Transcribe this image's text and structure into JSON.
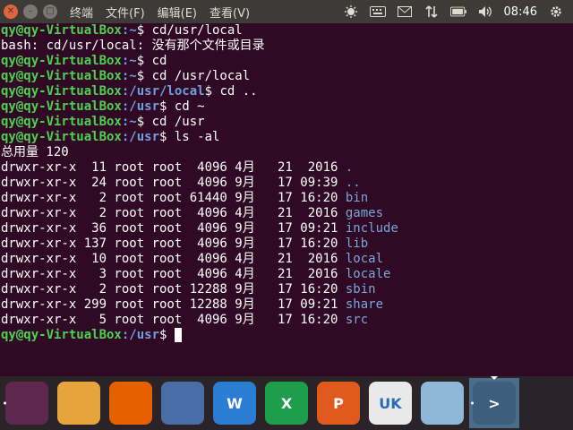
{
  "menubar": {
    "items": [
      "终端",
      "文件(F)",
      "编辑(E)",
      "查看(V)"
    ],
    "clock": "08:46"
  },
  "terminal": {
    "user_host": "qy@qy-VirtualBox",
    "lines": [
      {
        "type": "prompt",
        "path": ":~",
        "sym": "$ ",
        "cmd": "cd/usr/local"
      },
      {
        "type": "out",
        "text": "bash: cd/usr/local: 没有那个文件或目录"
      },
      {
        "type": "prompt",
        "path": ":~",
        "sym": "$ ",
        "cmd": "cd"
      },
      {
        "type": "prompt",
        "path": ":~",
        "sym": "$ ",
        "cmd": "cd /usr/local"
      },
      {
        "type": "prompt",
        "path": ":/usr/local",
        "sym": "$ ",
        "cmd": "cd .."
      },
      {
        "type": "prompt",
        "path": ":/usr",
        "sym": "$ ",
        "cmd": "cd ~"
      },
      {
        "type": "prompt",
        "path": ":~",
        "sym": "$ ",
        "cmd": "cd /usr"
      },
      {
        "type": "prompt",
        "path": ":/usr",
        "sym": "$ ",
        "cmd": "ls -al"
      },
      {
        "type": "out",
        "text": "总用量 120"
      }
    ],
    "listing": [
      {
        "meta": "drwxr-xr-x  11 root root  4096 4月   21  2016 ",
        "name": "."
      },
      {
        "meta": "drwxr-xr-x  24 root root  4096 9月   17 09:39 ",
        "name": ".."
      },
      {
        "meta": "drwxr-xr-x   2 root root 61440 9月   17 16:20 ",
        "name": "bin"
      },
      {
        "meta": "drwxr-xr-x   2 root root  4096 4月   21  2016 ",
        "name": "games"
      },
      {
        "meta": "drwxr-xr-x  36 root root  4096 9月   17 09:21 ",
        "name": "include"
      },
      {
        "meta": "drwxr-xr-x 137 root root  4096 9月   17 16:20 ",
        "name": "lib"
      },
      {
        "meta": "drwxr-xr-x  10 root root  4096 4月   21  2016 ",
        "name": "local"
      },
      {
        "meta": "drwxr-xr-x   3 root root  4096 4月   21  2016 ",
        "name": "locale"
      },
      {
        "meta": "drwxr-xr-x   2 root root 12288 9月   17 16:20 ",
        "name": "sbin"
      },
      {
        "meta": "drwxr-xr-x 299 root root 12288 9月   17 09:21 ",
        "name": "share"
      },
      {
        "meta": "drwxr-xr-x   5 root root  4096 9月   17 16:20 ",
        "name": "src"
      }
    ],
    "final_prompt": {
      "path": ":/usr",
      "sym": "$ "
    }
  },
  "dock": {
    "items": [
      {
        "name": "ubuntu-dash-icon",
        "bg": "#5e2750",
        "label": ""
      },
      {
        "name": "files-icon",
        "bg": "#e8a33d",
        "label": ""
      },
      {
        "name": "firefox-icon",
        "bg": "#e66000",
        "label": ""
      },
      {
        "name": "chromium-icon",
        "bg": "#4a6da7",
        "label": ""
      },
      {
        "name": "wps-writer-icon",
        "bg": "#2b7cd3",
        "label": "W"
      },
      {
        "name": "wps-spreadsheet-icon",
        "bg": "#1e9e4a",
        "label": "X"
      },
      {
        "name": "wps-presentation-icon",
        "bg": "#e05a1e",
        "label": "P"
      },
      {
        "name": "ubuntu-kylin-uk-icon",
        "bg": "#e9e9e9",
        "label": "UK"
      },
      {
        "name": "software-updater-icon",
        "bg": "#8fb8d8",
        "label": ""
      },
      {
        "name": "terminal-icon",
        "bg": "#3b5f7d",
        "label": ">"
      },
      {
        "name": "system-tools-icon",
        "bg": "#2a2428",
        "label": ""
      }
    ]
  }
}
